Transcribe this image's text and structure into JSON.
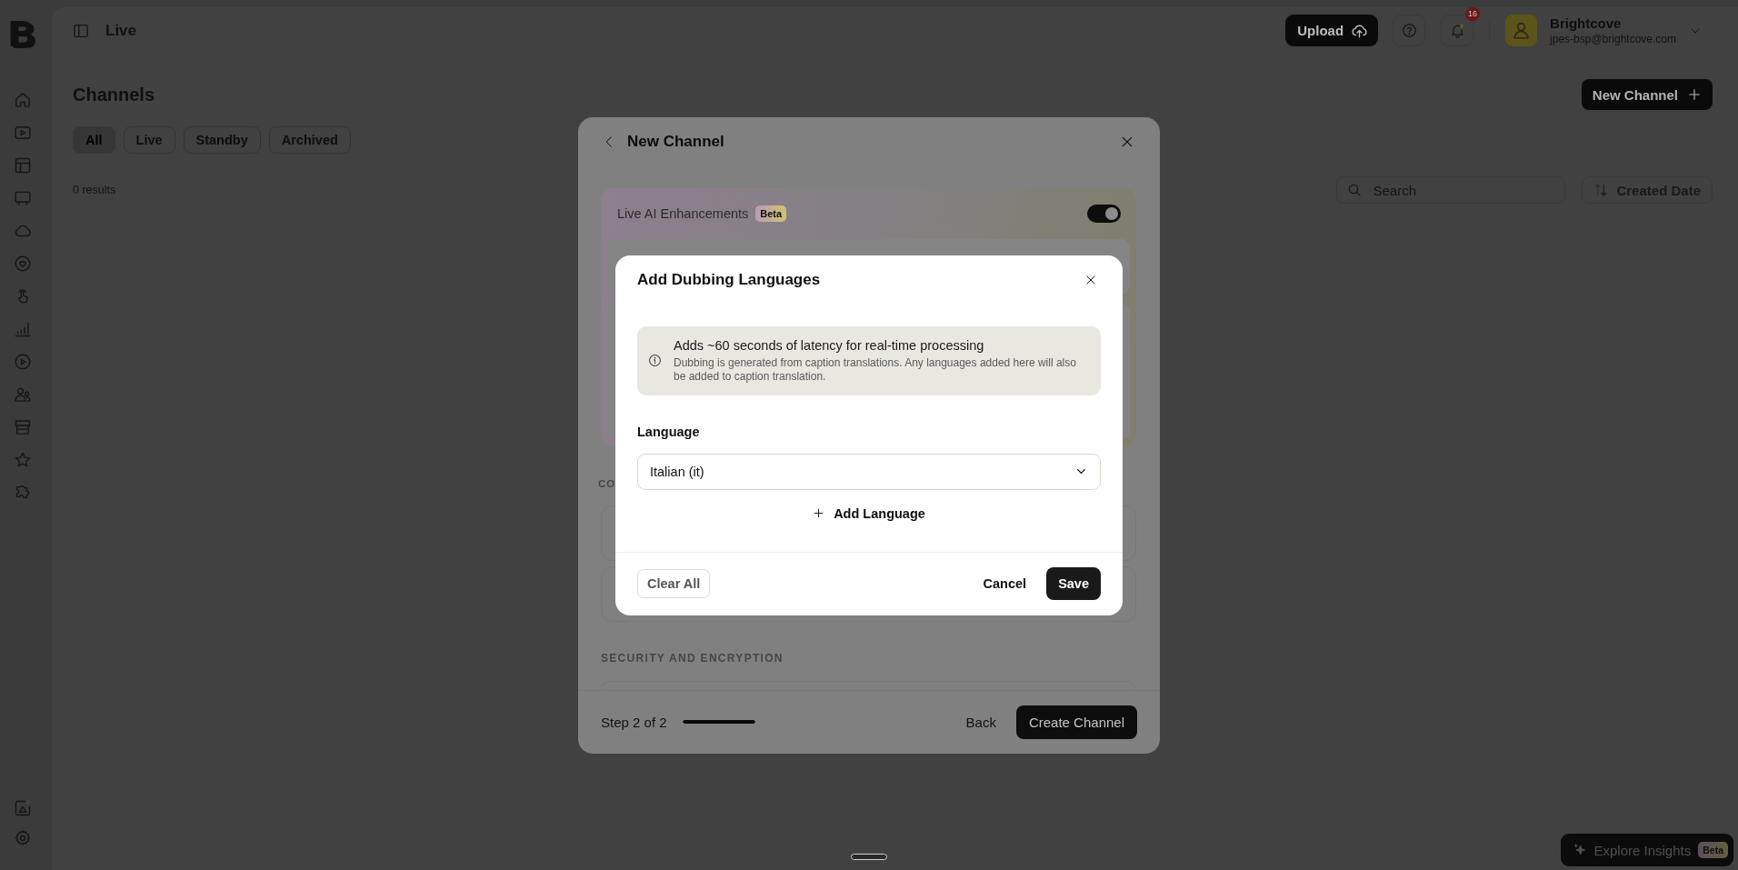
{
  "sidebar": {
    "logo": "B"
  },
  "header": {
    "title": "Live",
    "upload_button": "Upload",
    "notification_count": "16",
    "account": {
      "name": "Brightcove",
      "email": "jpes-bsp@brightcove.com"
    }
  },
  "page": {
    "title": "Channels",
    "new_channel_button": "New Channel",
    "tabs": [
      {
        "label": "All",
        "selected": true
      },
      {
        "label": "Live",
        "selected": false
      },
      {
        "label": "Standby",
        "selected": false
      },
      {
        "label": "Archived",
        "selected": false
      }
    ],
    "results_count": "0 results",
    "search": {
      "placeholder": "Search"
    },
    "sort_button": "Created Date"
  },
  "new_channel_modal": {
    "title": "New Channel",
    "ai_enhancements": {
      "label": "Live AI Enhancements",
      "badge": "Beta",
      "on": true
    },
    "section_label": "CO",
    "security_label": "SECURITY AND ENCRYPTION",
    "step": "Step 2 of 2",
    "progress": {
      "level": 1
    },
    "back_button": "Back",
    "create_button": "Create Channel"
  },
  "dubbing_dialog": {
    "title": "Add Dubbing Languages",
    "notice": {
      "title": "Adds ~60 seconds of latency for real-time processing",
      "body": "Dubbing is generated from caption translations. Any languages added here will also be added to caption translation."
    },
    "language_label": "Language",
    "language_select": {
      "value": "Italian (it)"
    },
    "add_language_button": "Add Language",
    "clear_button": "Clear All",
    "cancel_button": "Cancel",
    "save_button": "Save"
  },
  "insights_button": {
    "label": "Explore Insights",
    "badge": "Beta"
  }
}
